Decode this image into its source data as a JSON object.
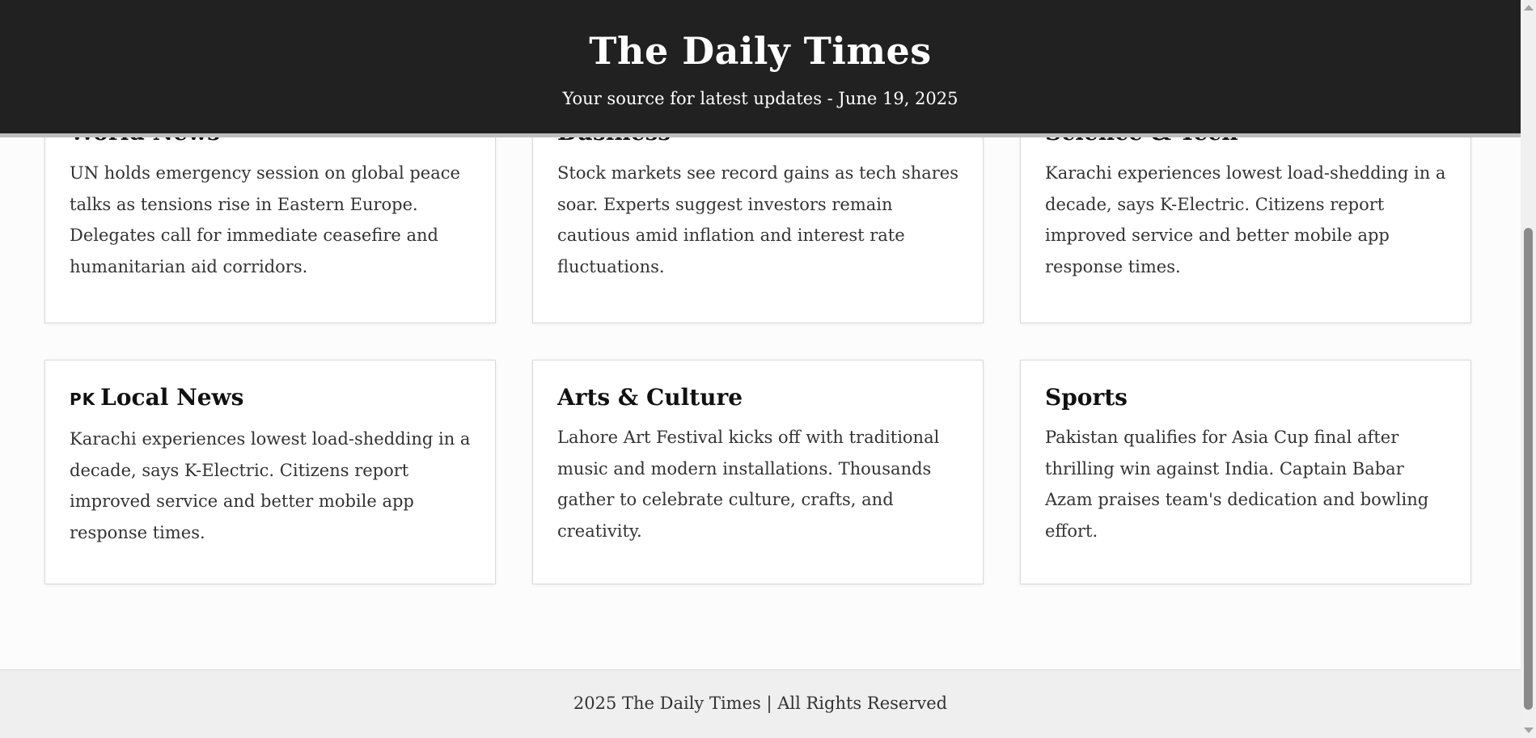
{
  "header": {
    "title": "The Daily Times",
    "tagline": "Your source for latest updates - June 19, 2025"
  },
  "cards": [
    {
      "title": "World News",
      "body": "UN holds emergency session on global peace talks as tensions rise in Eastern Europe. Delegates call for immediate ceasefire and humanitarian aid corridors."
    },
    {
      "title": "Business",
      "body": "Stock markets see record gains as tech shares soar. Experts suggest investors remain cautious amid inflation and interest rate fluctuations."
    },
    {
      "title": "Science & Tech",
      "body": "Karachi experiences lowest load-shedding in a decade, says K-Electric. Citizens report improved service and better mobile app response times."
    },
    {
      "flag": "PK",
      "title": "Local News",
      "body": "Karachi experiences lowest load-shedding in a decade, says K-Electric. Citizens report improved service and better mobile app response times."
    },
    {
      "title": "Arts & Culture",
      "body": "Lahore Art Festival kicks off with traditional music and modern installations. Thousands gather to celebrate culture, crafts, and creativity."
    },
    {
      "title": "Sports",
      "body": "Pakistan qualifies for Asia Cup final after thrilling win against India. Captain Babar Azam praises team's dedication and bowling effort."
    }
  ],
  "footer": {
    "text": "2025 The Daily Times | All Rights Reserved"
  },
  "colors": {
    "header_bg": "#212121",
    "header_border": "#bdbdbd",
    "page_bg": "#fcfcfc",
    "card_bg": "#ffffff",
    "footer_bg": "#efefef"
  }
}
